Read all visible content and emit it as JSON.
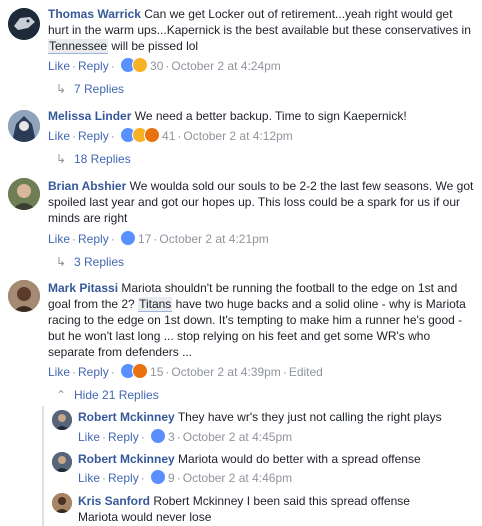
{
  "comments": [
    {
      "name": "Thomas Warrick",
      "text": "Can we get Locker out of retirement...yeah right would get hurt in the warm ups...Kapernick is the best available but these conservatives in ",
      "tag": "Tennessee",
      "text_after": " will be pissed lol",
      "like": "Like",
      "reply": "Reply",
      "reactions": [
        "like",
        "haha"
      ],
      "count": "30",
      "time": "October 2 at 4:24pm",
      "replies": "7 Replies"
    },
    {
      "name": "Melissa Linder",
      "text": "We need a better backup. Time to sign Kaepernick!",
      "like": "Like",
      "reply": "Reply",
      "reactions": [
        "like",
        "haha",
        "angry"
      ],
      "count": "41",
      "time": "October 2 at 4:12pm",
      "replies": "18 Replies"
    },
    {
      "name": "Brian Abshier",
      "text": "We woulda sold our souls to be 2-2 the last few seasons. We got spoiled last year and got our hopes up. This loss could be a spark for us if our minds are right",
      "like": "Like",
      "reply": "Reply",
      "reactions": [
        "like"
      ],
      "count": "17",
      "time": "October 2 at 4:21pm",
      "replies": "3 Replies"
    },
    {
      "name": "Mark Pitassi",
      "text_before": "Mariota shouldn't be running the football to the edge on 1st and goal from the 2? ",
      "tag": "Titans",
      "text": " have two huge backs and a solid oline - why is Mariota racing to the edge on 1st down. It's tempting to make him a runner he's good - but he won't last long ... stop relying on his feet and get some WR's who separate from defenders ...",
      "like": "Like",
      "reply": "Reply",
      "reactions": [
        "like",
        "angry"
      ],
      "count": "15",
      "time": "October 2 at 4:39pm",
      "edited": "Edited",
      "replies": "Hide 21 Replies"
    }
  ],
  "replies": [
    {
      "name": "Robert Mckinney",
      "text": "They have wr's they just not calling the right plays",
      "like": "Like",
      "reply": "Reply",
      "count": "3",
      "time": "October 2 at 4:45pm"
    },
    {
      "name": "Robert Mckinney",
      "text": "Mariota would do better with a spread offense",
      "like": "Like",
      "reply": "Reply",
      "count": "9",
      "time": "October 2 at 4:46pm"
    },
    {
      "name": "Kris Sanford",
      "text": "Robert Mckinney I been said this spread offense Mariota would never lose"
    }
  ],
  "colors": {
    "link": "#365899",
    "action": "#4267b2",
    "meta": "#90949c"
  }
}
